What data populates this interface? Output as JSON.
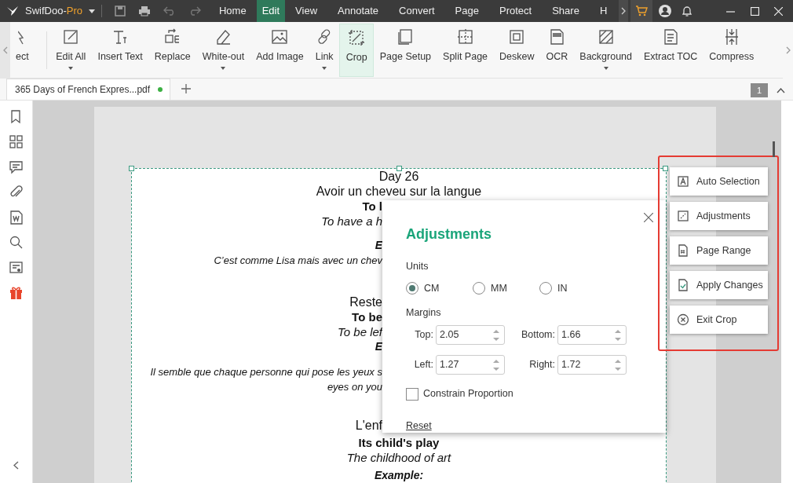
{
  "title_bar": {
    "app_name": "SwifDoo-",
    "edition": "Pro",
    "menu": [
      {
        "label": "Home",
        "selected": false
      },
      {
        "label": "Edit",
        "selected": true
      },
      {
        "label": "View",
        "selected": false
      },
      {
        "label": "Annotate",
        "selected": false
      },
      {
        "label": "Convert",
        "selected": false
      },
      {
        "label": "Page",
        "selected": false
      },
      {
        "label": "Protect",
        "selected": false
      },
      {
        "label": "Share",
        "selected": false
      },
      {
        "label": "H",
        "selected": false
      }
    ]
  },
  "ribbon": {
    "cut_tool_label": "ect",
    "tools": [
      {
        "label": "Edit All",
        "kind": "edit-all",
        "dropdown": true,
        "selected": false
      },
      {
        "label": "Insert Text",
        "kind": "insert-text",
        "dropdown": false,
        "selected": false
      },
      {
        "label": "Replace",
        "kind": "replace",
        "dropdown": false,
        "selected": false
      },
      {
        "label": "White-out",
        "kind": "white-out",
        "dropdown": true,
        "selected": false
      },
      {
        "label": "Add Image",
        "kind": "add-image",
        "dropdown": false,
        "selected": false
      },
      {
        "label": "Link",
        "kind": "link",
        "dropdown": true,
        "selected": false
      },
      {
        "label": "Crop",
        "kind": "crop",
        "dropdown": false,
        "selected": true
      },
      {
        "label": "Page Setup",
        "kind": "page-setup",
        "dropdown": false,
        "selected": false
      },
      {
        "label": "Split Page",
        "kind": "split-page",
        "dropdown": false,
        "selected": false
      },
      {
        "label": "Deskew",
        "kind": "deskew",
        "dropdown": false,
        "selected": false
      },
      {
        "label": "OCR",
        "kind": "ocr",
        "dropdown": false,
        "selected": false
      },
      {
        "label": "Background",
        "kind": "background",
        "dropdown": true,
        "selected": false
      },
      {
        "label": "Extract TOC",
        "kind": "extract-toc",
        "dropdown": false,
        "selected": false
      },
      {
        "label": "Compress",
        "kind": "compress",
        "dropdown": false,
        "selected": false
      }
    ]
  },
  "document_tabs": [
    {
      "label": "365 Days of French Expres...pdf",
      "modified": true,
      "selected": true
    }
  ],
  "page_indicator": "1",
  "page_lines": [
    {
      "text": "Day 26",
      "kind": "expression"
    },
    {
      "text": "Avoir un cheveu sur la langue",
      "kind": "expression"
    },
    {
      "text": "To l",
      "kind": "translation"
    },
    {
      "text": "To have a h",
      "kind": "meaning"
    },
    {
      "text": "E",
      "kind": "example-heading"
    },
    {
      "text": "C’est comme Lisa mais avec un chev",
      "kind": "example"
    },
    {
      "text": "Reste",
      "kind": "expression"
    },
    {
      "text": "To be",
      "kind": "translation"
    },
    {
      "text": "To be lef",
      "kind": "meaning"
    },
    {
      "text": "E",
      "kind": "example-heading"
    },
    {
      "text": "Il semble que chaque personne qui pose les yeux s",
      "kind": "example"
    },
    {
      "text": "eyes on you",
      "kind": "example"
    },
    {
      "text": "L'enf",
      "kind": "expression"
    },
    {
      "text": "Its child's play",
      "kind": "translation"
    },
    {
      "text": "The childhood of art",
      "kind": "meaning"
    },
    {
      "text": "Example:",
      "kind": "example-heading"
    }
  ],
  "adjustments_dialog": {
    "title": "Adjustments",
    "units_label": "Units",
    "units": [
      {
        "label": "CM",
        "selected": true
      },
      {
        "label": "MM",
        "selected": false
      },
      {
        "label": "IN",
        "selected": false
      }
    ],
    "margins_label": "Margins",
    "margins": [
      {
        "label": "Top:",
        "value": "2.05"
      },
      {
        "label": "Bottom:",
        "value": "1.66"
      },
      {
        "label": "Left:",
        "value": "1.27"
      },
      {
        "label": "Right:",
        "value": "1.72"
      }
    ],
    "constrain": {
      "label": "Constrain Proportion",
      "checked": false
    },
    "reset": "Reset"
  },
  "crop_tools": [
    {
      "label": "Auto Selection",
      "kind": "auto-selection"
    },
    {
      "label": "Adjustments",
      "kind": "adjustments"
    },
    {
      "label": "Page Range",
      "kind": "page-range"
    },
    {
      "label": "Apply Changes",
      "kind": "apply"
    },
    {
      "label": "Exit Crop",
      "kind": "exit"
    }
  ]
}
